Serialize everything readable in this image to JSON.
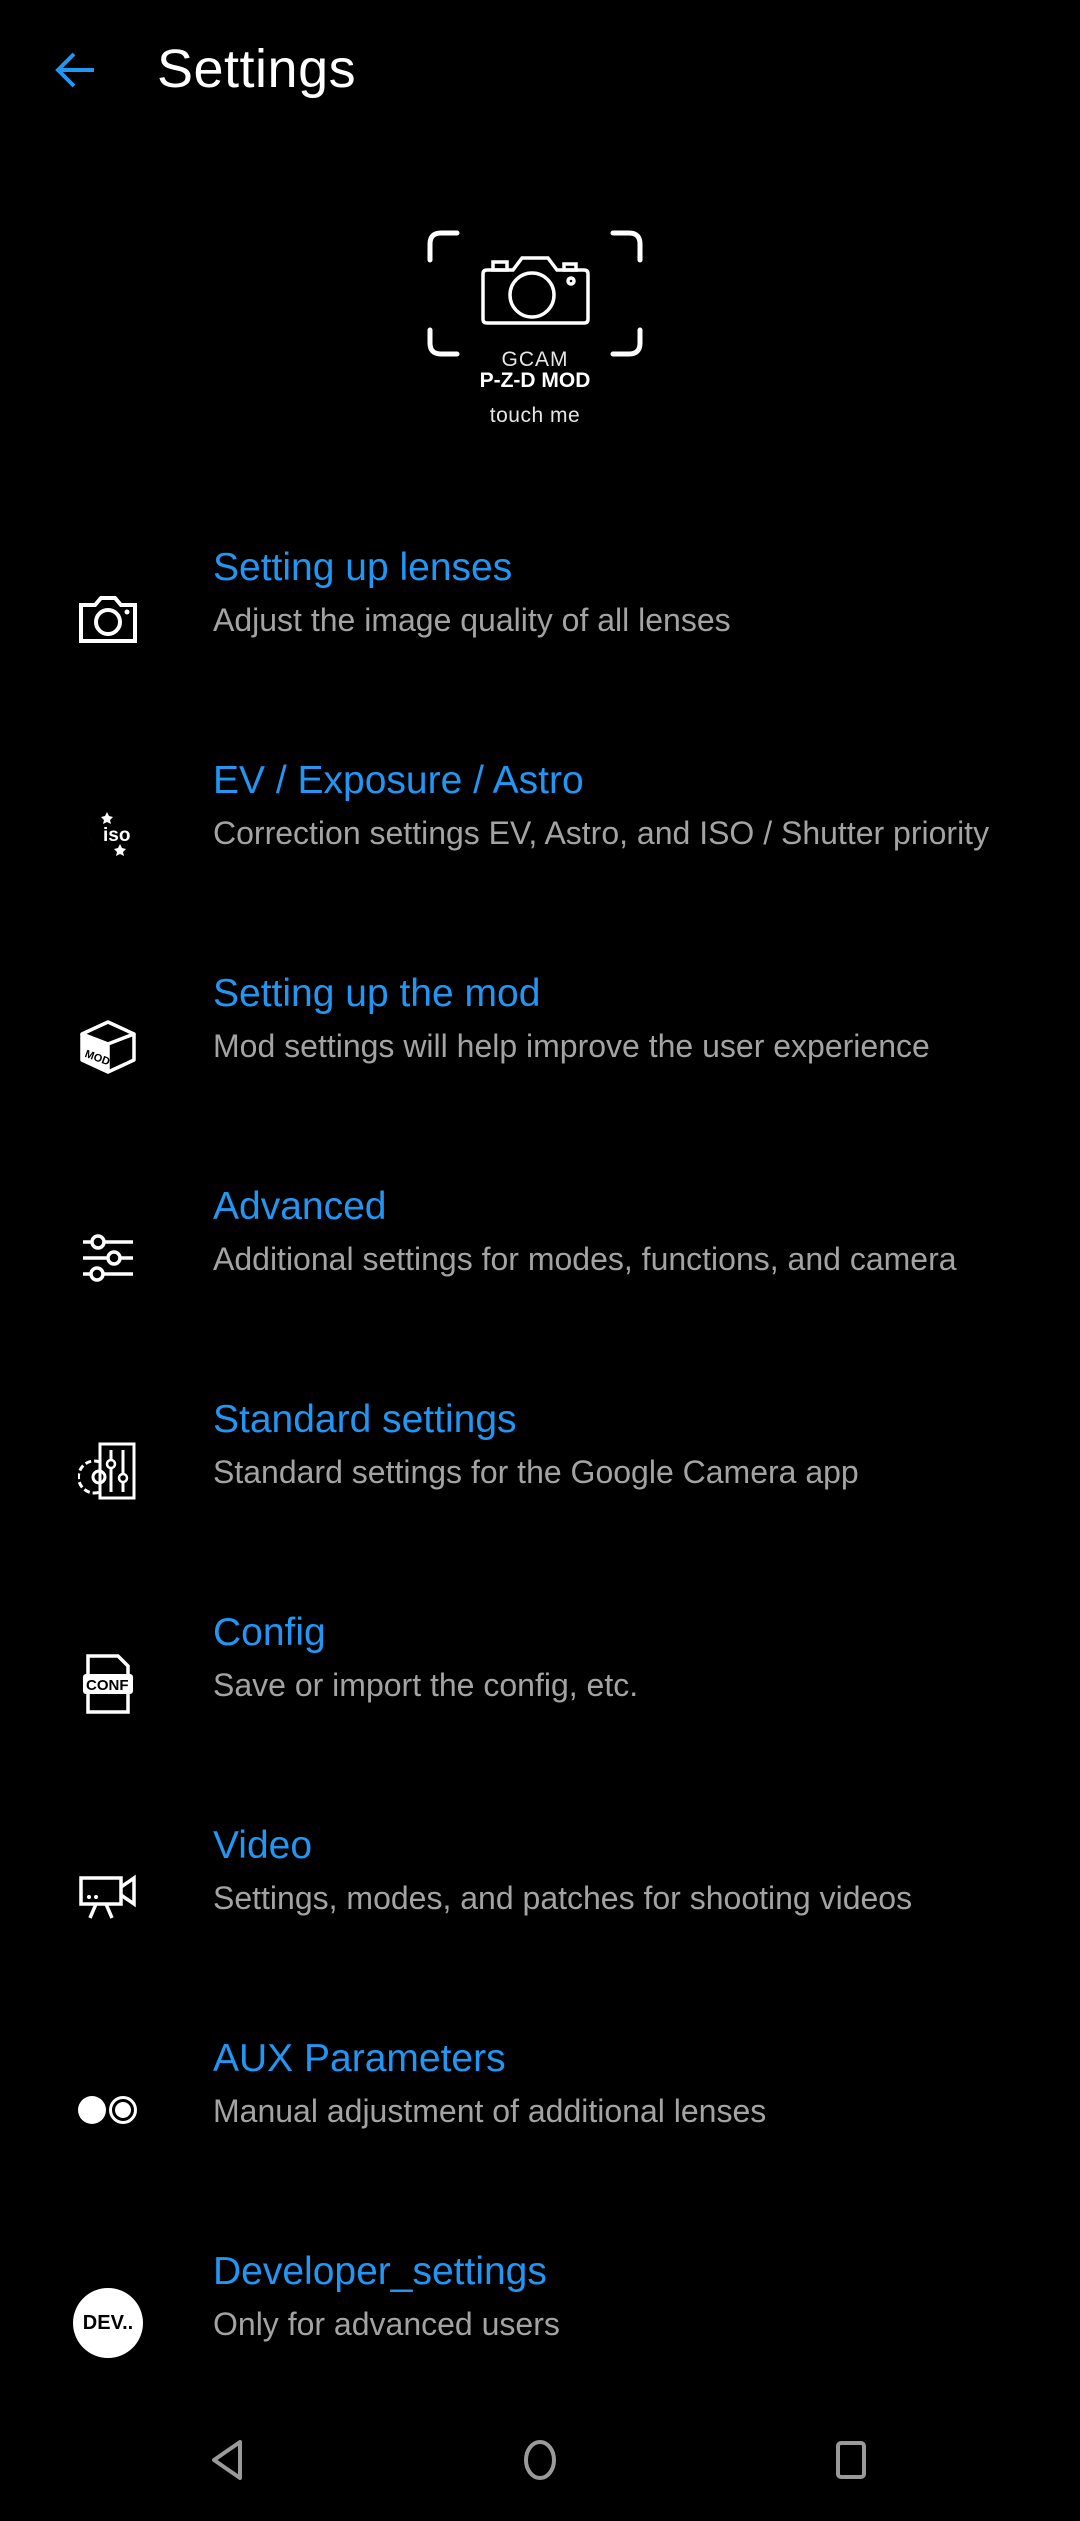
{
  "app_bar": {
    "title": "Settings",
    "back_icon": "arrow-back-icon",
    "accent_color": "#2196F3"
  },
  "logo": {
    "icon": "camera-frame-icon",
    "line1": "GCAM",
    "line2": "P-Z-D MOD",
    "caption": "touch me"
  },
  "items": [
    {
      "icon": "camera-icon",
      "title": "Setting up lenses",
      "subtitle": "Adjust the image quality of all lenses"
    },
    {
      "icon": "iso-moon-icon",
      "title": "EV / Exposure / Astro",
      "subtitle": "Correction settings EV, Astro, and ISO / Shutter priority"
    },
    {
      "icon": "mod-box-icon",
      "title": "Setting up the mod",
      "subtitle": "Mod settings will help improve the user experience"
    },
    {
      "icon": "sliders-icon",
      "title": "Advanced",
      "subtitle": "Additional settings for modes, functions, and camera"
    },
    {
      "icon": "gear-sliders-icon",
      "title": "Standard settings",
      "subtitle": "Standard settings for the Google Camera app"
    },
    {
      "icon": "conf-file-icon",
      "title": "Config",
      "subtitle": "Save or import the config, etc."
    },
    {
      "icon": "video-camera-icon",
      "title": "Video",
      "subtitle": "Settings, modes, and patches for shooting videos"
    },
    {
      "icon": "aux-lenses-icon",
      "title": "AUX Parameters",
      "subtitle": "Manual adjustment of additional lenses"
    },
    {
      "icon": "dev-badge-icon",
      "title": "Developer_settings",
      "subtitle": "Only for advanced users",
      "badge_text": "DEV.."
    }
  ],
  "nav_bar": {
    "back": "nav-back-icon",
    "home": "nav-home-icon",
    "recents": "nav-recents-icon"
  },
  "colors": {
    "background": "#000000",
    "title": "#2196F3",
    "subtitle": "#a3a3a3",
    "nav_icons": "#9a9a9a"
  }
}
